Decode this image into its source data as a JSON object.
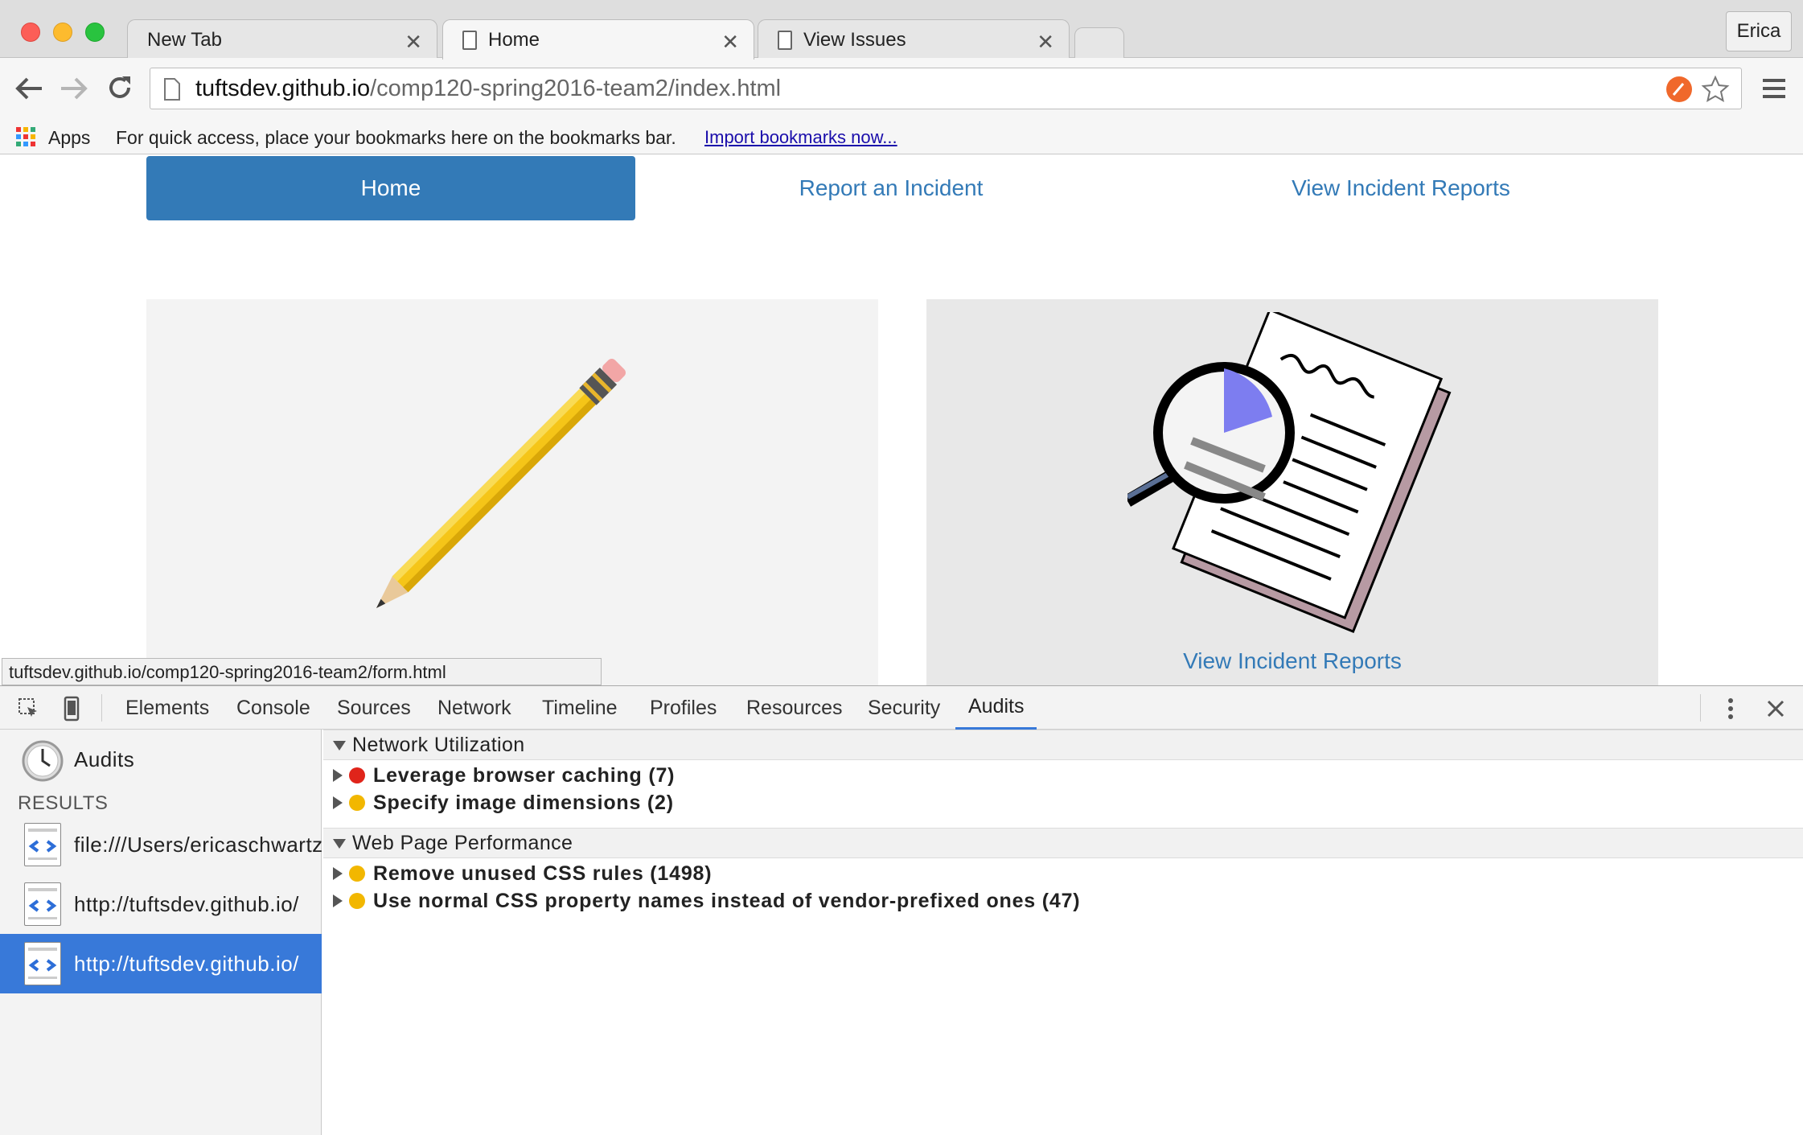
{
  "browser": {
    "tabs": [
      {
        "title": "New Tab"
      },
      {
        "title": "Home"
      },
      {
        "title": "View Issues"
      }
    ],
    "profile": "Erica",
    "url_host": "tuftsdev.github.io",
    "url_path": "/comp120-spring2016-team2/index.html",
    "bookmarks": {
      "apps_label": "Apps",
      "message": "For quick access, place your bookmarks here on the bookmarks bar.",
      "import_link": "Import bookmarks now..."
    },
    "status_url": "tuftsdev.github.io/comp120-spring2016-team2/form.html"
  },
  "page": {
    "nav": [
      "Home",
      "Report an Incident",
      "View Incident Reports"
    ],
    "right_caption": "View Incident Reports"
  },
  "devtools": {
    "tabs": [
      "Elements",
      "Console",
      "Sources",
      "Network",
      "Timeline",
      "Profiles",
      "Resources",
      "Security",
      "Audits"
    ],
    "sidebar": {
      "audits_label": "Audits",
      "results_label": "RESULTS",
      "results": [
        "file:///Users/ericaschwartz",
        "http://tuftsdev.github.io/",
        "http://tuftsdev.github.io/"
      ]
    },
    "sections": [
      {
        "title": "Network Utilization",
        "items": [
          {
            "label": "Leverage browser caching (7)",
            "severity": "red"
          },
          {
            "label": "Specify image dimensions (2)",
            "severity": "yellow"
          }
        ]
      },
      {
        "title": "Web Page Performance",
        "items": [
          {
            "label": "Remove unused CSS rules (1498)",
            "severity": "yellow"
          },
          {
            "label": "Use normal CSS property names instead of vendor-prefixed ones (47)",
            "severity": "yellow"
          }
        ]
      }
    ],
    "colors": {
      "accent": "#3879d9",
      "red": "#e0241a",
      "yellow": "#f2b700"
    }
  }
}
